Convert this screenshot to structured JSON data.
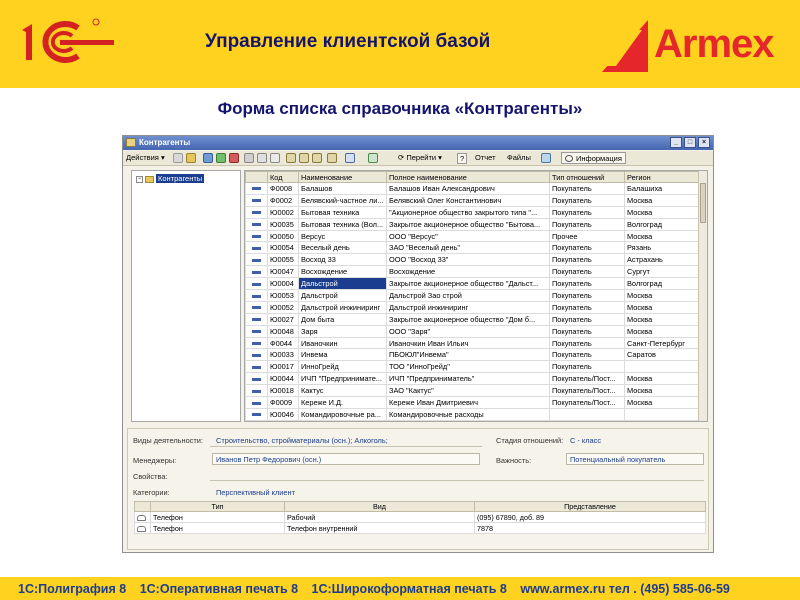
{
  "header": {
    "title": "Управление клиентской базой",
    "brand_text": "Armex",
    "colors": {
      "background": "#ffd21f",
      "title": "#14146e",
      "brand": "#e5262a"
    }
  },
  "subtitle": "Форма списка справочника «Контрагенты»",
  "window": {
    "title": "Контрагенты",
    "toolbar": {
      "actions_label": "Действия ▾",
      "goto_label": "Перейти ▾",
      "help_label": "?",
      "report_label": "Отчет",
      "files_label": "Файлы",
      "info_label": "Информация"
    },
    "tree": {
      "root_label": "Контрагенты"
    },
    "grid": {
      "columns": [
        "Код",
        "Наименование",
        "Полное наименование",
        "Тип отношений",
        "Регион"
      ],
      "rows": [
        {
          "code": "Ф0008",
          "name": "Балашов",
          "full": "Балашов Иван Александрович",
          "type": "Покупатель",
          "region": "Балашиха"
        },
        {
          "code": "Ф0002",
          "name": "Белявский-частное ли...",
          "full": "Белявский Олег Константинович",
          "type": "Покупатель",
          "region": "Москва"
        },
        {
          "code": "Ю0002",
          "name": "Бытовая техника",
          "full": "\"Акционерное общество закрытого типа \"...",
          "type": "Покупатель",
          "region": "Москва"
        },
        {
          "code": "Ю0035",
          "name": "Бытовая техника (Вол...",
          "full": "Закрытое акционерное общество \"Бытова...",
          "type": "Покупатель",
          "region": "Волгоград"
        },
        {
          "code": "Ю0050",
          "name": "Версус",
          "full": "ООО \"Версус\"",
          "type": "Прочее",
          "region": "Москва"
        },
        {
          "code": "Ю0054",
          "name": "Веселый день",
          "full": "ЗАО \"Веселый день\"",
          "type": "Покупатель",
          "region": "Рязань"
        },
        {
          "code": "Ю0055",
          "name": "Восход 33",
          "full": "ООО \"Восход 33\"",
          "type": "Покупатель",
          "region": "Астрахань"
        },
        {
          "code": "Ю0047",
          "name": "Восхождение",
          "full": "Восхождение",
          "type": "Покупатель",
          "region": "Сургут"
        },
        {
          "code": "Ю0004",
          "name": "Дальстрой",
          "full": "Закрытое акционерное общество \"Дальст...",
          "type": "Покупатель",
          "region": "Волгоград"
        },
        {
          "code": "Ю0053",
          "name": "Дальстрой",
          "full": "Дальстрой Зао строй",
          "type": "Покупатель",
          "region": "Москва"
        },
        {
          "code": "Ю0052",
          "name": "Дальстрой инжиниринг",
          "full": "Дальстрой инжиниринг",
          "type": "Покупатель",
          "region": "Москва"
        },
        {
          "code": "Ю0027",
          "name": "Дом быта",
          "full": "Закрытое акционерное общество \"Дом б...",
          "type": "Покупатель",
          "region": "Москва"
        },
        {
          "code": "Ю0048",
          "name": "Заря",
          "full": "ООО \"Заря\"",
          "type": "Покупатель",
          "region": "Москва"
        },
        {
          "code": "Ф0044",
          "name": "Иваночкин",
          "full": "Иваночкин Иван Ильич",
          "type": "Покупатель",
          "region": "Санкт-Петербург"
        },
        {
          "code": "Ю0033",
          "name": "Инвема",
          "full": "ПБОЮЛ\"Инвема\"",
          "type": "Покупатель",
          "region": "Саратов"
        },
        {
          "code": "Ю0017",
          "name": "ИнноГрейд",
          "full": "ТОО \"ИнноГрейд\"",
          "type": "Покупатель",
          "region": ""
        },
        {
          "code": "Ю0044",
          "name": "ИЧП \"Предпринимате...",
          "full": "ИЧП \"Предприниматель\"",
          "type": "Покупатель/Пост...",
          "region": "Москва"
        },
        {
          "code": "Ю0018",
          "name": "Кактус",
          "full": "ЗАО \"Кактус\"",
          "type": "Покупатель/Пост...",
          "region": "Москва"
        },
        {
          "code": "Ф0009",
          "name": "Кереже И.Д.",
          "full": "Кереже Иван Дмитриевич",
          "type": "Покупатель/Пост...",
          "region": "Москва"
        },
        {
          "code": "Ю0046",
          "name": "Командировочные ра...",
          "full": "Командировочные расходы",
          "type": "",
          "region": ""
        }
      ],
      "selected_index": 8
    },
    "details": {
      "activity_label": "Виды деятельности:",
      "activity_value": "Строительство, стройматериалы (осн.); Алкоголь;",
      "stage_label": "Стадия отношений:",
      "stage_value": "С - класс",
      "managers_label": "Менеджеры:",
      "managers_value": "Иванов Петр Федорович (осн.)",
      "importance_label": "Важность:",
      "importance_value": "Потенциальный покупатель",
      "properties_label": "Свойства:",
      "categories_label": "Категории:",
      "categories_value": "Перспективный клиент",
      "phones": {
        "columns": [
          "Тип",
          "Вид",
          "Представление"
        ],
        "rows": [
          {
            "type": "Телефон",
            "kind": "Рабочий",
            "repr": "(095) 67890, доб. 89"
          },
          {
            "type": "Телефон",
            "kind": "Телефон внутренний",
            "repr": "7878"
          }
        ]
      }
    }
  },
  "footer": {
    "items": [
      "1С:Полиграфия 8",
      "1С:Оперативная печать 8",
      "1С:Широкоформатная печать 8",
      "www.armex.ru тел . (495) 585-06-59"
    ]
  }
}
